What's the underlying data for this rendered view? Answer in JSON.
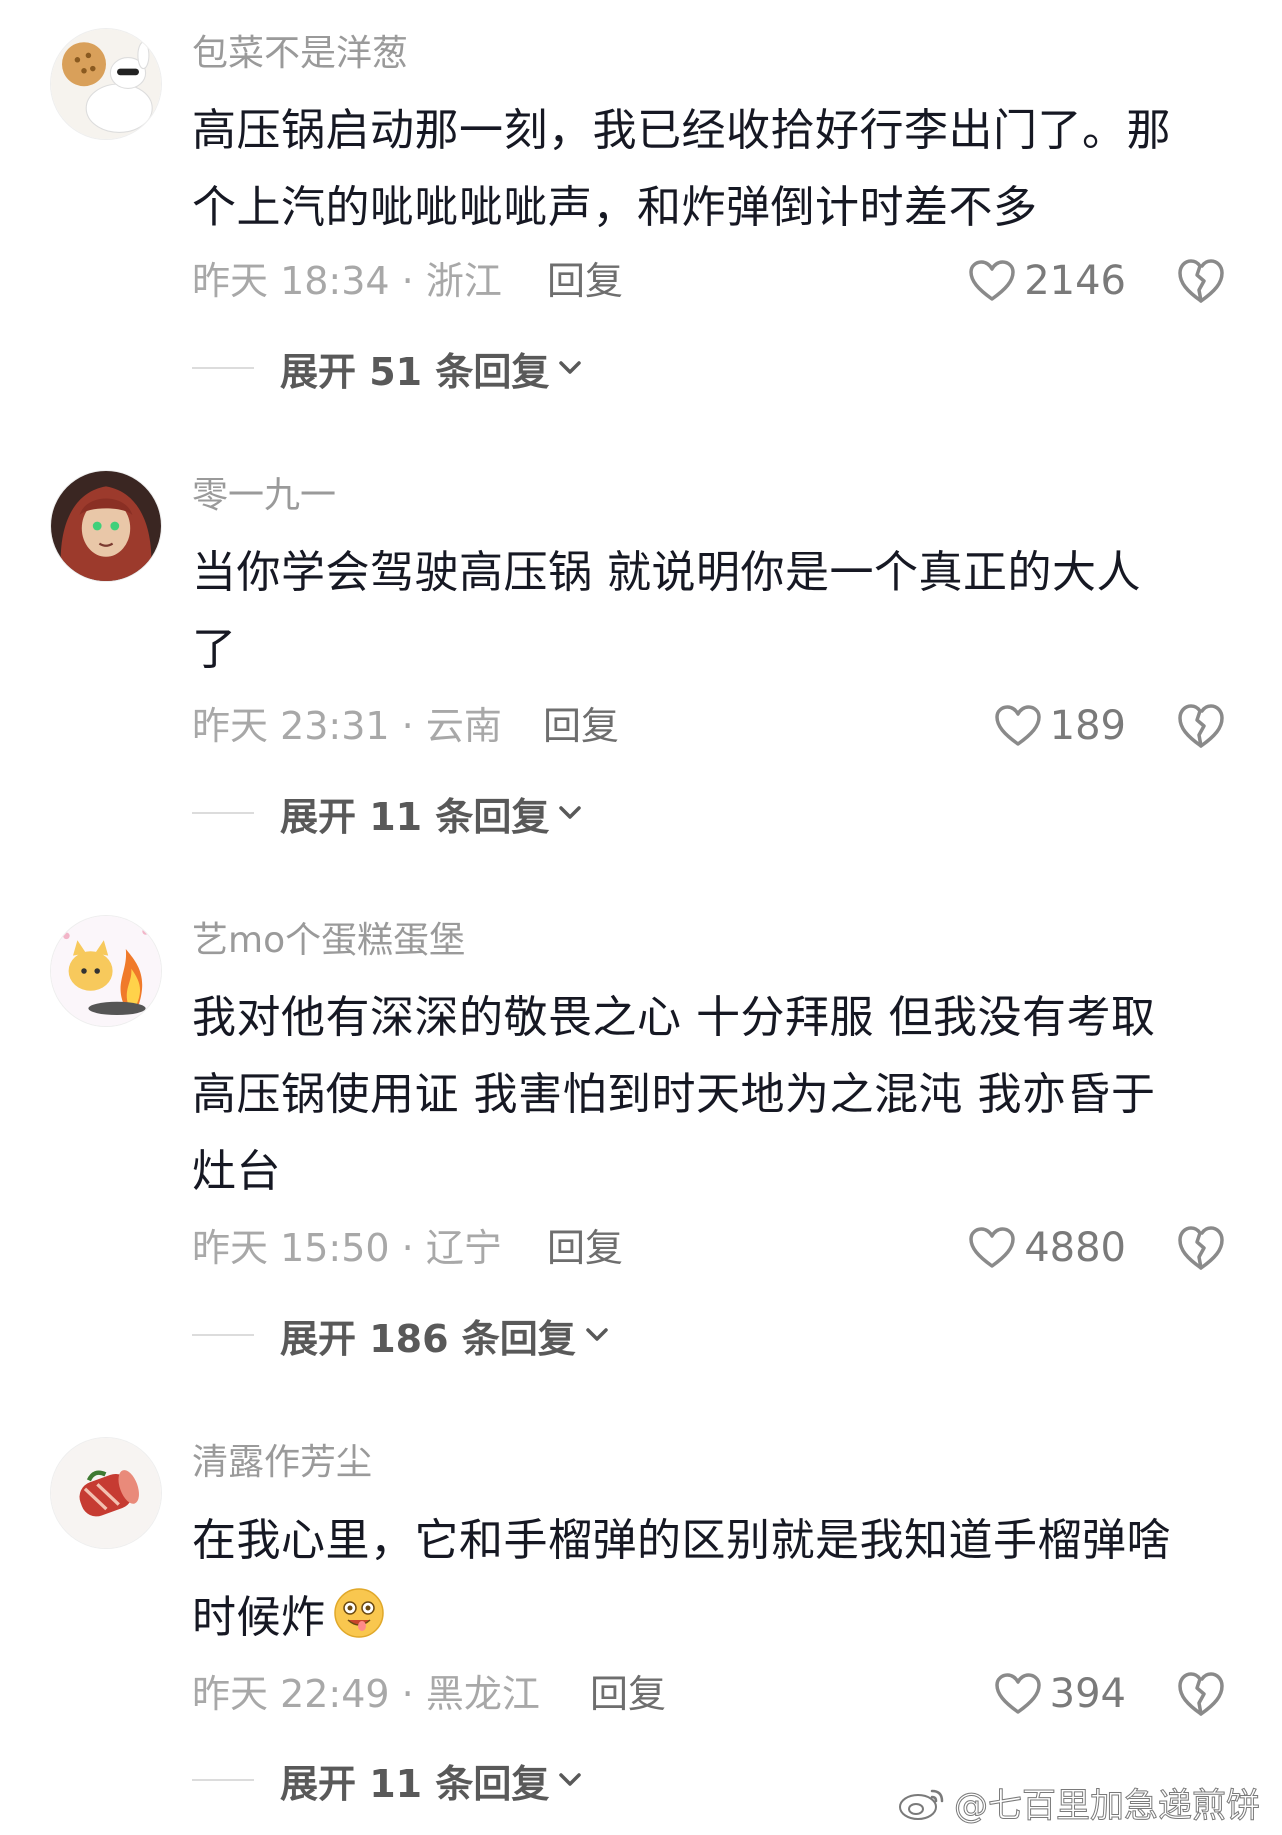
{
  "comments": [
    {
      "username": "包菜不是洋葱",
      "lines": [
        "高压锅启动那一刻，我已经收拾好行李出门了。那",
        "个上汽的呲呲呲呲声，和炸弹倒计时差不多"
      ],
      "time_location": "昨天 18:34 · 浙江",
      "reply_label": "回复",
      "likes": "2146",
      "expand_label": "展开 51 条回复"
    },
    {
      "username": "零一九一",
      "lines": [
        "当你学会驾驶高压锅 就说明你是一个真正的大人",
        "了"
      ],
      "time_location": "昨天 23:31 · 云南",
      "reply_label": "回复",
      "likes": "189",
      "expand_label": "展开 11 条回复"
    },
    {
      "username": "艺mo个蛋糕蛋堡",
      "lines": [
        "我对他有深深的敬畏之心 十分拜服 但我没有考取",
        "高压锅使用证 我害怕到时天地为之混沌 我亦昏于",
        "灶台"
      ],
      "time_location": "昨天 15:50 · 辽宁",
      "reply_label": "回复",
      "likes": "4880",
      "expand_label": "展开 186 条回复"
    },
    {
      "username": "清露作芳尘",
      "lines": [
        "在我心里，它和手榴弹的区别就是我知道手榴弹啥",
        "时候炸"
      ],
      "time_location": "昨天 22:49 · 黑龙江",
      "reply_label": "回复",
      "likes": "394",
      "expand_label": "展开 11 条回复"
    }
  ],
  "watermark": "@七百里加急递煎饼",
  "colors": {
    "text_main": "#161823",
    "text_meta": "#a8a8a8",
    "text_username": "#9a9a9a"
  }
}
